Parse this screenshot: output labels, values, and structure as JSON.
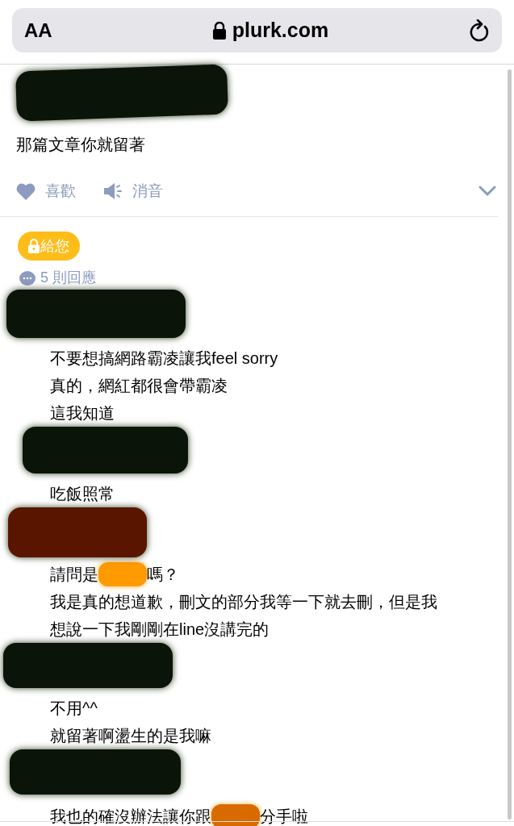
{
  "browser": {
    "text_size_button": "AA",
    "url": "plurk.com"
  },
  "post": {
    "color": "#0b1408",
    "text": "那篇文章你就留著",
    "actions": [
      {
        "kind": "like",
        "label": "喜歡"
      },
      {
        "kind": "mute",
        "label": "消音"
      }
    ]
  },
  "badge": "給您",
  "response_count": "5 則回應",
  "responses": [
    {
      "color": "#0b1408",
      "lines": [
        [
          {
            "kind": "text",
            "text": "不要想搞網路霸凌讓我feel sorry"
          }
        ],
        [
          {
            "kind": "text",
            "text": "真的，網紅都很會帶霸凌"
          }
        ],
        [
          {
            "kind": "text",
            "text": "這我知道"
          }
        ]
      ]
    },
    {
      "color": "#0b1408",
      "lines": [
        [
          {
            "kind": "text",
            "text": "吃飯照常"
          }
        ]
      ]
    },
    {
      "color": "#5a1500",
      "lines": [
        [
          {
            "kind": "text",
            "text": "請問是"
          },
          {
            "kind": "redaction",
            "color": "#ff9a00"
          },
          {
            "kind": "text",
            "text": "嗎？"
          }
        ],
        [
          {
            "kind": "text",
            "text": "我是真的想道歉，刪文的部分我等一下就去刪，但是我"
          }
        ],
        [
          {
            "kind": "text",
            "text": "想說一下我剛剛在line沒講完的"
          }
        ]
      ]
    },
    {
      "color": "#0b1408",
      "lines": [
        [
          {
            "kind": "text",
            "text": "不用^^"
          }
        ],
        [
          {
            "kind": "text",
            "text": "就留著啊盪生的是我嘛"
          }
        ]
      ]
    },
    {
      "color": "#0b1408",
      "lines": [
        [
          {
            "kind": "text",
            "text": "我也的確沒辦法讓你跟"
          },
          {
            "kind": "redaction",
            "color": "#d96a00"
          },
          {
            "kind": "text",
            "text": "分手啦"
          }
        ]
      ]
    }
  ]
}
